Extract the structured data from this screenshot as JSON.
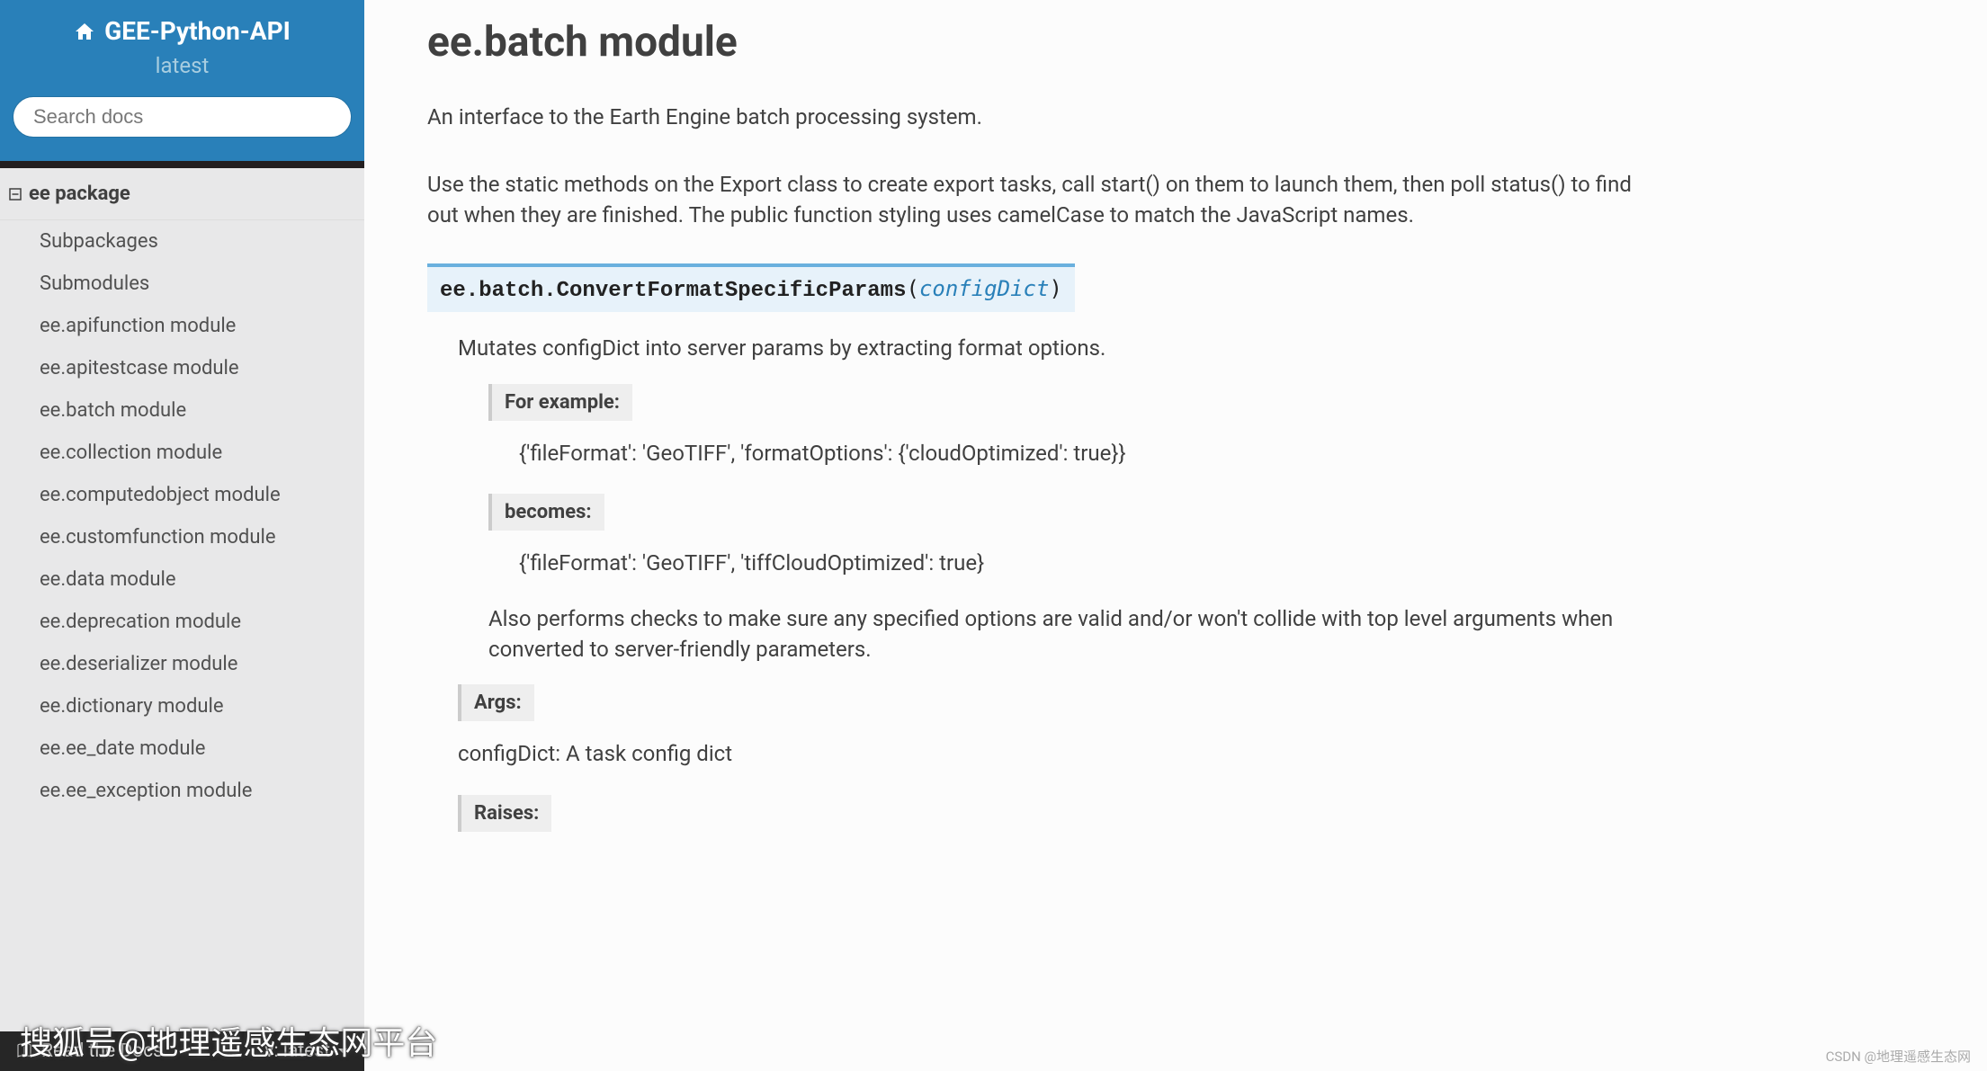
{
  "site": {
    "title": "GEE-Python-API",
    "version": "latest"
  },
  "search": {
    "placeholder": "Search docs"
  },
  "nav": {
    "heading": "ee package",
    "items": [
      "Subpackages",
      "Submodules",
      "ee.apifunction module",
      "ee.apitestcase module",
      "ee.batch module",
      "ee.collection module",
      "ee.computedobject module",
      "ee.customfunction module",
      "ee.data module",
      "ee.deprecation module",
      "ee.deserializer module",
      "ee.dictionary module",
      "ee.ee_date module",
      "ee.ee_exception module"
    ]
  },
  "rtd": {
    "left": "Read the Docs",
    "right": "v: latest"
  },
  "page": {
    "title": "ee.batch module",
    "intro": "An interface to the Earth Engine batch processing system.",
    "body": "Use the static methods on the Export class to create export tasks, call start() on them to launch them, then poll status() to find out when they are finished. The public function styling uses camelCase to match the JavaScript names.",
    "func": {
      "qualname": "ee.batch.ConvertFormatSpecificParams",
      "param": "configDict",
      "summary": "Mutates configDict into server params by extracting format options.",
      "example_label": "For example:",
      "example_in": "{'fileFormat': 'GeoTIFF', 'formatOptions': {'cloudOptimized': true}}",
      "becomes_label": "becomes:",
      "example_out": "{'fileFormat': 'GeoTIFF', 'tiffCloudOptimized': true}",
      "checks": "Also performs checks to make sure any specified options are valid and/or won't collide with top level arguments when converted to server-friendly parameters.",
      "args_label": "Args:",
      "args_body": "configDict: A task config dict",
      "raises_label": "Raises:"
    }
  },
  "watermark": {
    "left": "搜狐号@地理遥感生态网平台",
    "right": "CSDN @地理遥感生态网"
  }
}
